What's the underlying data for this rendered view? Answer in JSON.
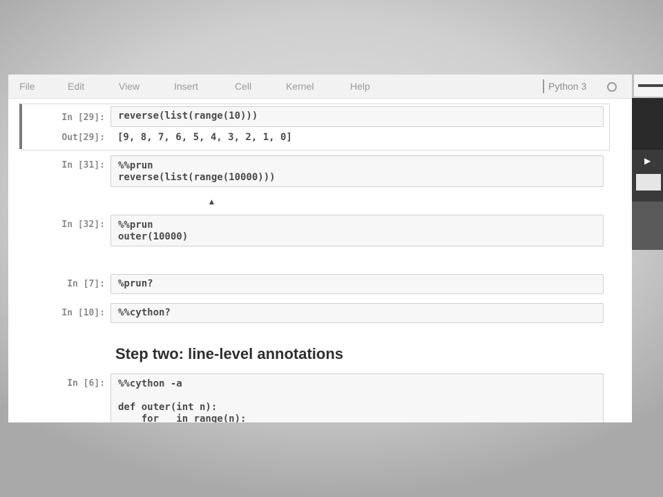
{
  "menu": {
    "items": [
      "File",
      "Edit",
      "View",
      "Insert",
      "Cell",
      "Kernel",
      "Help"
    ],
    "kernel_name": "Python 3"
  },
  "cells": {
    "c29": {
      "in_prompt": "In [29]:",
      "code": "reverse(list(range(10)))",
      "out_prompt": "Out[29]:",
      "output": "[9, 8, 7, 6, 5, 4, 3, 2, 1, 0]"
    },
    "c31": {
      "in_prompt": "In [31]:",
      "code": "%%prun\nreverse(list(range(10000)))"
    },
    "c32": {
      "in_prompt": "In [32]:",
      "code": "%%prun\nouter(10000)"
    },
    "c7": {
      "in_prompt": "In [7]:",
      "code": "%prun?"
    },
    "c10": {
      "in_prompt": "In [10]:",
      "code": "%%cython?"
    },
    "heading": "Step two: line-level annotations",
    "c6": {
      "in_prompt": "In [6]:",
      "code": "%%cython -a\n\ndef outer(int n):\n    for _ in range(n):"
    }
  },
  "icons": {
    "kernel_indicator": "circle-idle-icon",
    "cursor": "mouse-pointer-icon"
  },
  "colors": {
    "selected_cell_bar": "#7a7a7a",
    "input_background": "#f7f7f7",
    "prompt": "#8a8a8a"
  }
}
